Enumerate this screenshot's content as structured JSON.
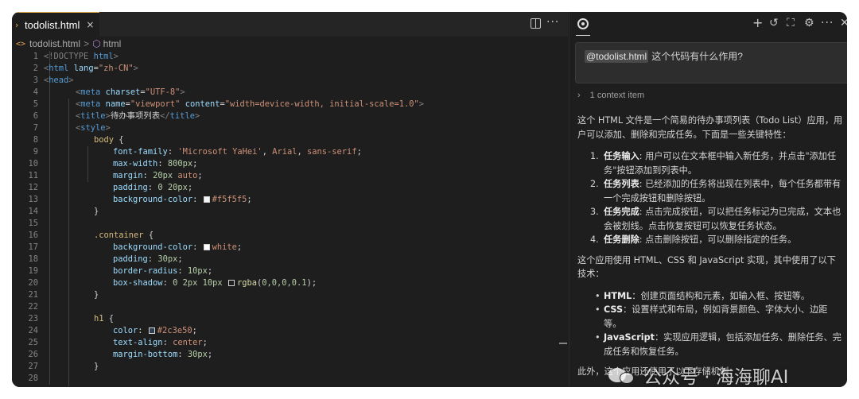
{
  "editor": {
    "tab": {
      "label": "todolist.html",
      "close": "×",
      "chevron": "›"
    },
    "actions": {
      "more": "···"
    },
    "breadcrumb": {
      "icon": "<>",
      "file": "todolist.html",
      "separator": ">",
      "element": "html"
    },
    "line_numbers": [
      "1",
      "2",
      "3",
      "4",
      "5",
      "6",
      "7",
      "8",
      "9",
      "10",
      "11",
      "12",
      "13",
      "14",
      "15",
      "16",
      "17",
      "18",
      "19",
      "20",
      "21",
      "22",
      "23",
      "24",
      "25",
      "26",
      "27",
      "28"
    ],
    "code": {
      "l1": [
        "<!DOCTYPE ",
        "html",
        ">"
      ],
      "l2": [
        "<",
        "html",
        " ",
        "lang",
        "=",
        "\"zh-CN\"",
        ">"
      ],
      "l3": [
        "<",
        "head",
        ">"
      ],
      "l4": [
        "<",
        "meta",
        " ",
        "charset",
        "=",
        "\"UTF-8\"",
        ">"
      ],
      "l5": [
        "<",
        "meta",
        " ",
        "name",
        "=",
        "\"viewport\"",
        " ",
        "content",
        "=",
        "\"width=device-width, initial-scale=1.0\"",
        ">"
      ],
      "l6": [
        "<",
        "title",
        ">",
        "待办事项列表",
        "</",
        "title",
        ">"
      ],
      "l7": [
        "<",
        "style",
        ">"
      ],
      "l8": [
        "body",
        " {"
      ],
      "l9": [
        "font-family",
        ": ",
        "'Microsoft YaHei'",
        ", ",
        "Arial",
        ", ",
        "sans-serif",
        ";"
      ],
      "l10": [
        "max-width",
        ": ",
        "800px",
        ";"
      ],
      "l11": [
        "margin",
        ": ",
        "20px",
        " ",
        "auto",
        ";"
      ],
      "l12": [
        "padding",
        ": ",
        "0",
        " ",
        "20px",
        ";"
      ],
      "l13": [
        "background-color",
        ": ",
        "#f5f5f5",
        ";"
      ],
      "l14": [
        "}"
      ],
      "l16": [
        ".container",
        " {"
      ],
      "l17": [
        "background-color",
        ": ",
        "white",
        ";"
      ],
      "l18": [
        "padding",
        ": ",
        "30px",
        ";"
      ],
      "l19": [
        "border-radius",
        ": ",
        "10px",
        ";"
      ],
      "l20": [
        "box-shadow",
        ": ",
        "0",
        " ",
        "2px",
        " ",
        "10px",
        " ",
        "rgba",
        "(",
        "0,0,0,0.1",
        ");"
      ],
      "l21": [
        "}"
      ],
      "l23": [
        "h1",
        " {"
      ],
      "l24": [
        "color",
        ": ",
        "#2c3e50",
        ";"
      ],
      "l25": [
        "text-align",
        ": ",
        "center",
        ";"
      ],
      "l26": [
        "margin-bottom",
        ": ",
        "30px",
        ";"
      ],
      "l27": [
        "}"
      ]
    },
    "swatch_colors": {
      "bg": "#f5f5f5",
      "white": "#ffffff",
      "shadow": "#1e1e1e",
      "h1": "#2c3e50"
    }
  },
  "chat": {
    "prompt": {
      "mention": "@todolist.html",
      "text": "这个代码有什么作用?"
    },
    "context": {
      "chevron": "›",
      "label": "1 context item"
    },
    "answer": {
      "intro": [
        "这个 HTML 文件是一个简易的待办事项列表（Todo List）应用，用",
        "户可以添加、删除和完成任务。下面是一些关键特性："
      ],
      "features": [
        {
          "num": "1.",
          "title": "任务输入",
          "lines": [
            ": 用户可以在文本框中输入新任务，并点击\"添加任",
            "务\"按钮添加到列表中。"
          ]
        },
        {
          "num": "2.",
          "title": "任务列表",
          "lines": [
            ": 已经添加的任务将出现在列表中，每个任务都带有",
            "一个完成按钮和删除按钮。"
          ]
        },
        {
          "num": "3.",
          "title": "任务完成",
          "lines": [
            ": 点击完成按钮，可以把任务标记为已完成，文本也",
            "会被划线。点击恢复按钮可以恢复任务状态。"
          ]
        },
        {
          "num": "4.",
          "title": "任务删除",
          "lines": [
            ": 点击删除按钮，可以删除指定的任务。"
          ]
        }
      ],
      "tech_intro": [
        "这个应用使用 HTML、CSS 和 JavaScript 实现，其中使用了以下",
        "技术："
      ],
      "tech": [
        {
          "bullet": "•",
          "title": "HTML",
          "lines": [
            "：创建页面结构和元素，如输入框、按钮等。"
          ]
        },
        {
          "bullet": "•",
          "title": "CSS",
          "lines": [
            "：设置样式和布局，例如背景颜色、字体大小、边距",
            "等。"
          ]
        },
        {
          "bullet": "•",
          "title": "JavaScript",
          "lines": [
            "：实现应用逻辑，包括添加任务、删除任务、完",
            "成任务和恢复任务。"
          ]
        }
      ],
      "outro": "此外，这个应用还使用了以下存储机制："
    }
  },
  "watermark": {
    "text": "公众号 · 海海聊AI"
  }
}
